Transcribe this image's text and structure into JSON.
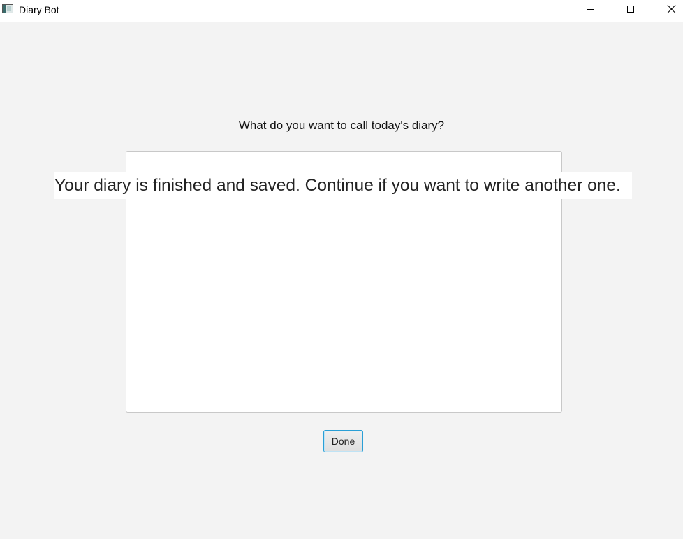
{
  "window": {
    "title": "Diary Bot",
    "app_icon": "window-app-icon"
  },
  "controls": {
    "minimize_icon": "minimize-icon",
    "maximize_icon": "maximize-icon",
    "close_icon": "close-icon"
  },
  "main": {
    "prompt": "What do you want to call today's diary?",
    "textarea_value": "",
    "status_message": "Your diary is finished and saved. Continue if you want to write another one.",
    "done_label": "Done"
  },
  "colors": {
    "background": "#f3f3f3",
    "focus_border": "#2a9fd6"
  }
}
